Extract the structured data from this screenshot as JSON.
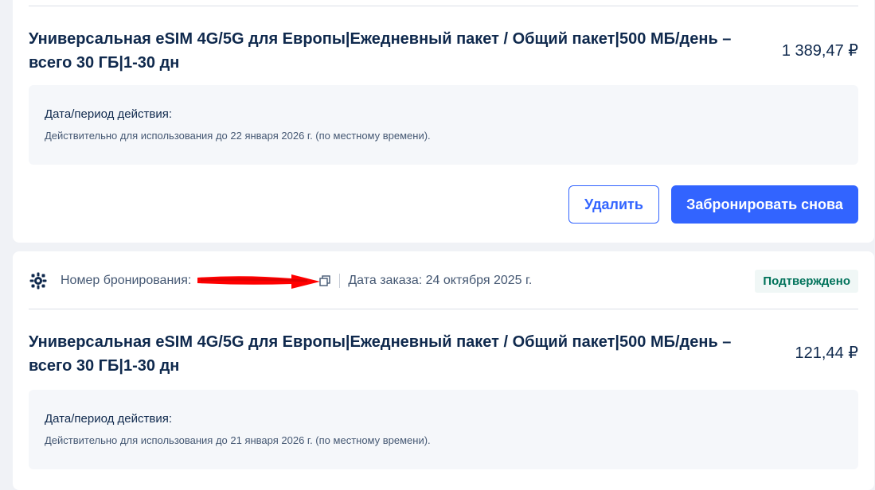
{
  "orders": [
    {
      "product_title": "Универсальная eSIM 4G/5G для Европы|Ежедневный пакет / Общий пакет|500 МБ/день – всего 30 ГБ|1-30 дн",
      "price": "1 389,47 ₽",
      "validity_label": "Дата/период действия:",
      "validity_text": "Действительно для использования до 22 января 2026 г. (по местному времени).",
      "delete_label": "Удалить",
      "rebook_label": "Забронировать снова"
    },
    {
      "booking_number_label": "Номер бронирования:",
      "order_date_text": "Дата заказа: 24 октября 2025 г.",
      "status": "Подтверждено",
      "product_title": "Универсальная eSIM 4G/5G для Европы|Ежедневный пакет / Общий пакет|500 МБ/день – всего 30 ГБ|1-30 дн",
      "price": "121,44 ₽",
      "validity_label": "Дата/период действия:",
      "validity_text": "Действительно для использования до 21 января 2026 г. (по местному времени)."
    }
  ],
  "colors": {
    "primary": "#3264ff",
    "status_text": "#00725a",
    "annotation_arrow": "#ff0000"
  },
  "icons": {
    "brand": "esim-logo-icon",
    "copy": "copy-icon"
  }
}
